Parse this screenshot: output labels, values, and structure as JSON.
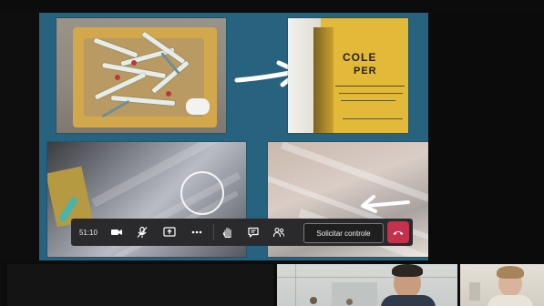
{
  "slide": {
    "collector_label_line1": "COLE",
    "collector_label_line2": "PER"
  },
  "toolbar": {
    "call_duration": "51:10",
    "request_control_label": "Solicitar controle",
    "icons": {
      "camera": "camera-icon",
      "mic": "mic-muted-icon",
      "share": "share-screen-icon",
      "more": "more-icon",
      "raise_hand": "raise-hand-icon",
      "chat": "chat-icon",
      "participants": "participants-icon",
      "hangup": "hang-up-icon"
    }
  },
  "colors": {
    "slide_background": "#27627f",
    "toolbar_background": "#2a2a2c",
    "hangup_red": "#c4314b"
  }
}
